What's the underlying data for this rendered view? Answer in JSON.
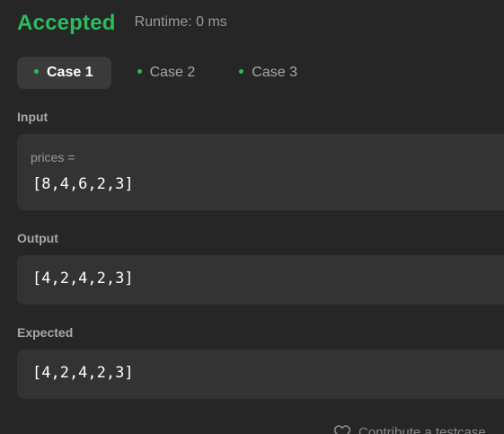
{
  "result": {
    "status": "Accepted",
    "runtime": "Runtime: 0 ms",
    "status_color": "#2cbb5d"
  },
  "tabs": [
    {
      "label": "Case 1",
      "active": true
    },
    {
      "label": "Case 2",
      "active": false
    },
    {
      "label": "Case 3",
      "active": false
    }
  ],
  "input": {
    "label": "Input",
    "variable": "prices =",
    "value": "[8,4,6,2,3]"
  },
  "output": {
    "label": "Output",
    "value": "[4,2,4,2,3]"
  },
  "expected": {
    "label": "Expected",
    "value": "[4,2,4,2,3]"
  },
  "footer": {
    "contribute_label": "Contribute a testcase",
    "icon": "heart-icon"
  }
}
